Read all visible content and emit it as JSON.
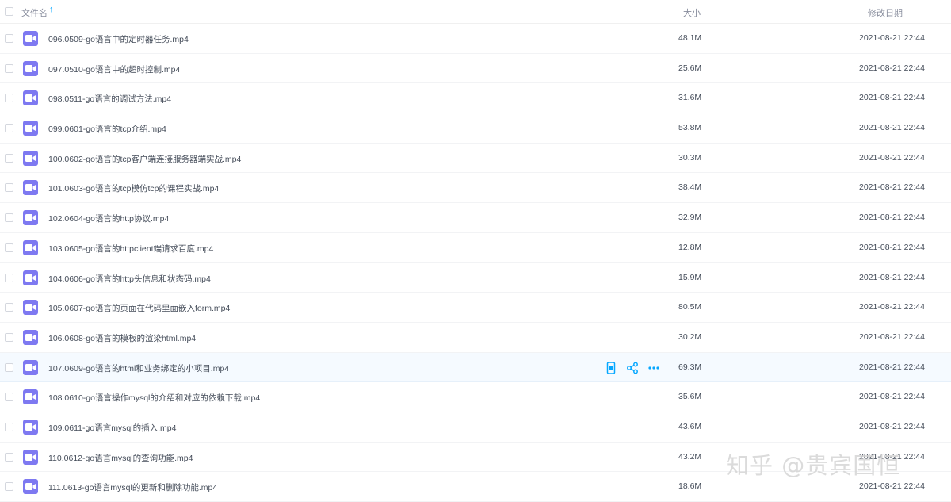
{
  "header": {
    "name_label": "文件名",
    "size_label": "大小",
    "date_label": "修改日期"
  },
  "files": [
    {
      "name": "096.0509-go语言中的定时器任务.mp4",
      "size": "48.1M",
      "date": "2021-08-21 22:44"
    },
    {
      "name": "097.0510-go语言中的超时控制.mp4",
      "size": "25.6M",
      "date": "2021-08-21 22:44"
    },
    {
      "name": "098.0511-go语言的调试方法.mp4",
      "size": "31.6M",
      "date": "2021-08-21 22:44"
    },
    {
      "name": "099.0601-go语言的tcp介绍.mp4",
      "size": "53.8M",
      "date": "2021-08-21 22:44"
    },
    {
      "name": "100.0602-go语言的tcp客户端连接服务器端实战.mp4",
      "size": "30.3M",
      "date": "2021-08-21 22:44"
    },
    {
      "name": "101.0603-go语言的tcp模仿tcp的课程实战.mp4",
      "size": "38.4M",
      "date": "2021-08-21 22:44"
    },
    {
      "name": "102.0604-go语言的http协议.mp4",
      "size": "32.9M",
      "date": "2021-08-21 22:44"
    },
    {
      "name": "103.0605-go语言的httpclient端请求百度.mp4",
      "size": "12.8M",
      "date": "2021-08-21 22:44"
    },
    {
      "name": "104.0606-go语言的http头信息和状态码.mp4",
      "size": "15.9M",
      "date": "2021-08-21 22:44"
    },
    {
      "name": "105.0607-go语言的页面在代码里面嵌入form.mp4",
      "size": "80.5M",
      "date": "2021-08-21 22:44"
    },
    {
      "name": "106.0608-go语言的模板的渲染html.mp4",
      "size": "30.2M",
      "date": "2021-08-21 22:44"
    },
    {
      "name": "107.0609-go语言的html和业务绑定的小项目.mp4",
      "size": "69.3M",
      "date": "2021-08-21 22:44"
    },
    {
      "name": "108.0610-go语言操作mysql的介绍和对应的依赖下载.mp4",
      "size": "35.6M",
      "date": "2021-08-21 22:44"
    },
    {
      "name": "109.0611-go语言mysql的插入.mp4",
      "size": "43.6M",
      "date": "2021-08-21 22:44"
    },
    {
      "name": "110.0612-go语言mysql的查询功能.mp4",
      "size": "43.2M",
      "date": "2021-08-21 22:44"
    },
    {
      "name": "111.0613-go语言mysql的更新和删除功能.mp4",
      "size": "18.6M",
      "date": "2021-08-21 22:44"
    }
  ],
  "watermark": "知乎 @贵宾国恒",
  "icons": {
    "file": "video-file-icon",
    "sort": "sort-up-arrow-icon",
    "actions": [
      "mobile-icon",
      "share-icon",
      "more-icon"
    ]
  },
  "colors": {
    "accent": "#06a7ff",
    "file_icon": "#7e79f1",
    "hover_row": "#f5faff"
  }
}
